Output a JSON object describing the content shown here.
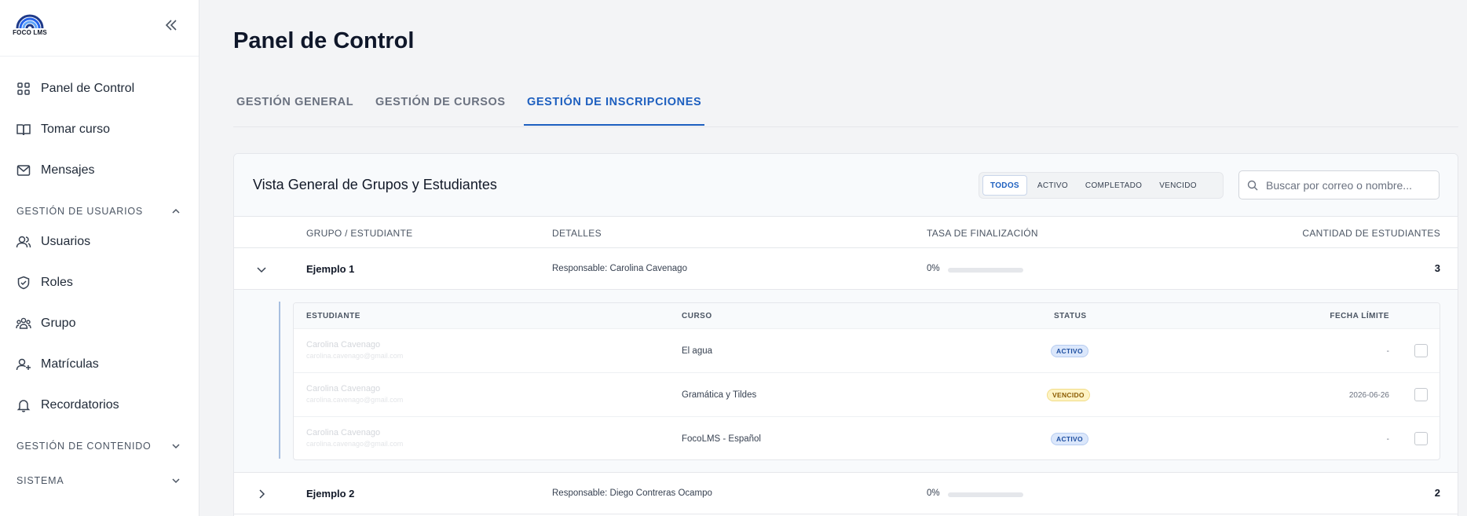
{
  "brand": {
    "logo_text": "FOCO LMS"
  },
  "sidebar": {
    "items": [
      {
        "label": "Panel de Control",
        "icon": "grid-icon"
      },
      {
        "label": "Tomar curso",
        "icon": "book-icon"
      },
      {
        "label": "Mensajes",
        "icon": "mail-icon"
      }
    ],
    "sections": [
      {
        "label": "GESTIÓN DE USUARIOS",
        "expanded": true
      },
      {
        "label": "GESTIÓN DE CONTENIDO",
        "expanded": false
      },
      {
        "label": "SISTEMA",
        "expanded": false
      }
    ],
    "user_items": [
      {
        "label": "Usuarios",
        "icon": "users-icon"
      },
      {
        "label": "Roles",
        "icon": "shield-icon"
      },
      {
        "label": "Grupo",
        "icon": "group-icon"
      },
      {
        "label": "Matrículas",
        "icon": "user-plus-icon"
      },
      {
        "label": "Recordatorios",
        "icon": "bell-icon"
      }
    ]
  },
  "page": {
    "title": "Panel de Control"
  },
  "tabs": [
    {
      "label": "GESTIÓN GENERAL",
      "active": false
    },
    {
      "label": "GESTIÓN DE CURSOS",
      "active": false
    },
    {
      "label": "GESTIÓN DE INSCRIPCIONES",
      "active": true
    }
  ],
  "card": {
    "title": "Vista General de Grupos y Estudiantes",
    "filters": [
      {
        "label": "TODOS",
        "active": true
      },
      {
        "label": "ACTIVO",
        "active": false
      },
      {
        "label": "COMPLETADO",
        "active": false
      },
      {
        "label": "VENCIDO",
        "active": false
      }
    ],
    "search_placeholder": "Buscar por correo o nombre..."
  },
  "table": {
    "columns": {
      "group": "GRUPO / ESTUDIANTE",
      "details": "DETALLES",
      "rate": "TASA DE FINALIZACIÓN",
      "count": "CANTIDAD DE ESTUDIANTES"
    },
    "groups": [
      {
        "name": "Ejemplo 1",
        "responsable": "Responsable: Carolina Cavenago",
        "rate_label": "0%",
        "rate": 0,
        "count": "3",
        "expanded": true
      },
      {
        "name": "Ejemplo 2",
        "responsable": "Responsable: Diego Contreras Ocampo",
        "rate_label": "0%",
        "rate": 0,
        "count": "2",
        "expanded": false
      }
    ]
  },
  "students_table": {
    "columns": {
      "student": "ESTUDIANTE",
      "course": "CURSO",
      "status": "STATUS",
      "deadline": "FECHA LÍMITE"
    },
    "rows": [
      {
        "name": "Carolina Cavenago",
        "email": "carolina.cavenago@gmail.com",
        "course": "El agua",
        "status": "ACTIVO",
        "deadline": "-"
      },
      {
        "name": "Carolina Cavenago",
        "email": "carolina.cavenago@gmail.com",
        "course": "Gramática y Tildes",
        "status": "VENCIDO",
        "deadline": "2026-06-26"
      },
      {
        "name": "Carolina Cavenago",
        "email": "carolina.cavenago@gmail.com",
        "course": "FocoLMS - Español",
        "status": "ACTIVO",
        "deadline": "-"
      }
    ]
  },
  "colors": {
    "accent": "#1d5fbf",
    "activo_bg": "#dbe7fb",
    "vencido_bg": "#fdf3c4"
  }
}
